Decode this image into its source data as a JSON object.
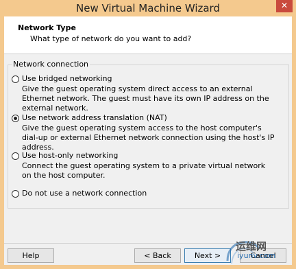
{
  "window": {
    "title": "New Virtual Machine Wizard",
    "close_glyph": "✕"
  },
  "header": {
    "title": "Network Type",
    "subtitle": "What type of network do you want to add?"
  },
  "group": {
    "legend": "Network connection"
  },
  "options": [
    {
      "label": "Use bridged networking",
      "accel": "r",
      "selected": false,
      "description": "Give the guest operating system direct access to an external Ethernet network. The guest must have its own IP address on the external network."
    },
    {
      "label": "Use network address translation (NAT)",
      "accel": "e",
      "selected": true,
      "description": "Give the guest operating system access to the host computer's dial-up or external Ethernet network connection using the host's IP address."
    },
    {
      "label": "Use host-only networking",
      "accel": "h",
      "selected": false,
      "description": "Connect the guest operating system to a private virtual network on the host computer."
    },
    {
      "label": "Do not use a network connection",
      "accel": "t",
      "selected": false,
      "description": ""
    }
  ],
  "buttons": {
    "help": "Help",
    "back": "< Back",
    "next": "Next >",
    "cancel": "Cancel"
  },
  "watermark": {
    "text": "运维网",
    "sub": "iyunv.com"
  }
}
